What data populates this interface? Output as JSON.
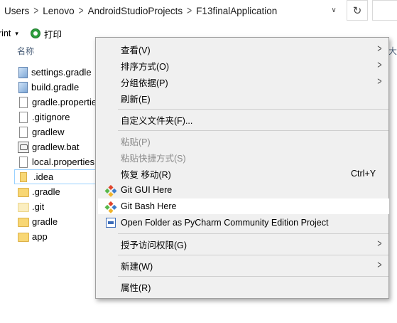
{
  "address_bar": {
    "crumbs": [
      "Users",
      "Lenovo",
      "AndroidStudioProjects",
      "F13finalApplication"
    ],
    "separator": ">",
    "dropdown_glyph": "∨",
    "refresh_glyph": "↻"
  },
  "command_bar": {
    "print_partial": "rint",
    "dropdown_glyph": "▾",
    "print_label": "打印"
  },
  "file_list": {
    "column_name": "名称",
    "column_right_partial": "大",
    "files": [
      {
        "name": "settings.gradle",
        "icon": "gradle-file-icon"
      },
      {
        "name": "build.gradle",
        "icon": "gradle-file-icon"
      },
      {
        "name": "gradle.properties",
        "icon": "text-file-icon"
      },
      {
        "name": ".gitignore",
        "icon": "text-file-icon"
      },
      {
        "name": "gradlew",
        "icon": "text-file-icon"
      },
      {
        "name": "gradlew.bat",
        "icon": "batch-file-icon"
      },
      {
        "name": "local.properties",
        "icon": "text-file-icon"
      },
      {
        "name": ".idea",
        "icon": "folder-icon",
        "selected": true
      },
      {
        "name": ".gradle",
        "icon": "folder-icon"
      },
      {
        "name": ".git",
        "icon": "folder-icon"
      },
      {
        "name": "gradle",
        "icon": "folder-icon"
      },
      {
        "name": "app",
        "icon": "folder-icon"
      }
    ]
  },
  "context_menu": {
    "arrow_glyph": ">",
    "items": [
      {
        "label": "查看(V)",
        "submenu": true
      },
      {
        "label": "排序方式(O)",
        "submenu": true
      },
      {
        "label": "分组依据(P)",
        "submenu": true
      },
      {
        "label": "刷新(E)"
      },
      {
        "label": "自定义文件夹(F)..."
      },
      {
        "label": "粘贴(P)",
        "disabled": true
      },
      {
        "label": "粘贴快捷方式(S)",
        "disabled": true
      },
      {
        "label": "恢复 移动(R)",
        "shortcut": "Ctrl+Y"
      },
      {
        "label": "Git GUI Here",
        "icon": "git-icon"
      },
      {
        "label": "Git Bash Here",
        "icon": "git-icon",
        "highlighted": true
      },
      {
        "label": "Open Folder as PyCharm Community Edition Project",
        "icon": "pycharm-icon"
      },
      {
        "label": "授予访问权限(G)",
        "submenu": true
      },
      {
        "label": "新建(W)",
        "submenu": true
      },
      {
        "label": "属性(R)"
      }
    ]
  },
  "colors": {
    "menu_bg": "#f0f0f0",
    "menu_hover": "#ffffff",
    "selection_border": "#99d1ff",
    "folder": "#f8d775",
    "git_red": "#e0442c",
    "git_green": "#58b84a",
    "git_blue": "#3d7ccb",
    "git_yellow": "#f0b429"
  }
}
